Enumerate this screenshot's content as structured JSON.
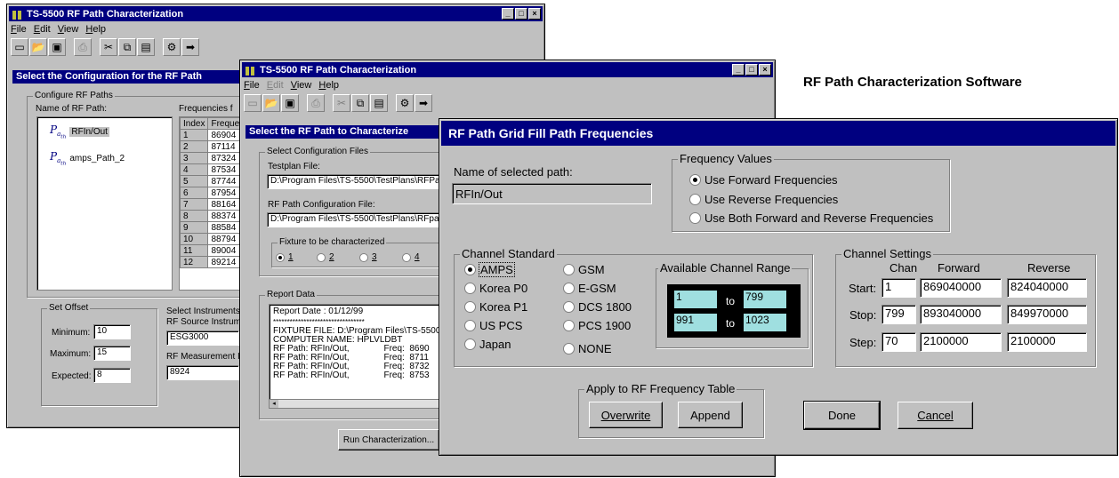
{
  "caption": "RF Path Characterization Software",
  "win1": {
    "title": "TS-5500 RF Path Characterization",
    "menu": [
      "File",
      "Edit",
      "View",
      "Help"
    ],
    "inner_title": "Select the Configuration for the RF Path",
    "configure_group": "Configure RF Paths",
    "name_col_label": "Name of RF Path:",
    "freq_col_label": "Frequencies f",
    "paths": [
      "RFIn/Out",
      "amps_Path_2"
    ],
    "table_headers": [
      "Index",
      "Freque"
    ],
    "rows": [
      [
        "1",
        "86904"
      ],
      [
        "2",
        "87114"
      ],
      [
        "3",
        "87324"
      ],
      [
        "4",
        "87534"
      ],
      [
        "5",
        "87744"
      ],
      [
        "6",
        "87954"
      ],
      [
        "7",
        "88164"
      ],
      [
        "8",
        "88374"
      ],
      [
        "9",
        "88584"
      ],
      [
        "10",
        "88794"
      ],
      [
        "11",
        "89004"
      ],
      [
        "12",
        "89214"
      ]
    ],
    "offset_group": "Set Offset",
    "minimum_label": "Minimum:",
    "minimum_value": "10",
    "maximum_label": "Maximum:",
    "maximum_value": "15",
    "expected_label": "Expected:",
    "expected_value": "8",
    "instruments_label": "Select Instruments",
    "source_label": "RF Source Instrume",
    "source_value": "ESG3000",
    "measure_label": "RF Measurement In",
    "measure_value": "8924"
  },
  "win2": {
    "title": "TS-5500 RF Path Characterization",
    "menu": [
      "File",
      "Edit",
      "View",
      "Help"
    ],
    "inner_title": "Select the RF Path to Characterize",
    "config_group": "Select Configuration Files",
    "testplan_label": "Testplan File:",
    "testplan_value": "D:\\Program Files\\TS-5500\\TestPlans\\RFPa",
    "rfconfig_label": "RF Path Configuration File:",
    "rfconfig_value": "D:\\Program Files\\TS-5500\\TestPlans\\RFpa",
    "fixture_group": "Fixture to be characterized",
    "fixtures": [
      "1",
      "2",
      "3",
      "4"
    ],
    "report_group": "Report Data",
    "report_lines": [
      "Report Date :  01/12/99",
      "*********************************",
      "FIXTURE FILE: D:\\Program Files\\TS-5500",
      "COMPUTER NAME: HPLVLDBT",
      "RF Path: RFIn/Out,              Freq:  8690",
      "RF Path: RFIn/Out,              Freq:  8711",
      "RF Path: RFIn/Out,              Freq:  8732",
      "RF Path: RFIn/Out,              Freq:  8753"
    ],
    "run_button": "Run Characterization..."
  },
  "dialog": {
    "title": "RF Path Grid Fill Path Frequencies",
    "name_label": "Name of selected path:",
    "name_value": "RFIn/Out",
    "freq_group": "Frequency Values",
    "freq_options": [
      "Use Forward Frequencies",
      "Use Reverse Frequencies",
      "Use Both Forward and Reverse Frequencies"
    ],
    "freq_selected": 0,
    "std_group": "Channel Standard",
    "std_col1": [
      "AMPS",
      "Korea P0",
      "Korea P1",
      "US PCS",
      "Japan"
    ],
    "std_col2": [
      "GSM",
      "E-GSM",
      "DCS 1800",
      "PCS 1900",
      "NONE"
    ],
    "range_group": "Available Channel Range",
    "range_rows": [
      [
        "1",
        "799"
      ],
      [
        "991",
        "1023"
      ]
    ],
    "range_to": "to",
    "settings_group": "Channel Settings",
    "settings_headers": [
      "Chan",
      "Forward",
      "Reverse"
    ],
    "settings_rows": [
      {
        "label": "Start:",
        "chan": "1",
        "forward": "869040000",
        "reverse": "824040000"
      },
      {
        "label": "Stop:",
        "chan": "799",
        "forward": "893040000",
        "reverse": "849970000"
      },
      {
        "label": "Step:",
        "chan": "70",
        "forward": "2100000",
        "reverse": "2100000"
      }
    ],
    "apply_group": "Apply to RF Frequency Table",
    "overwrite_button": "Overwrite",
    "append_button": "Append",
    "done_button": "Done",
    "cancel_button": "Cancel"
  }
}
